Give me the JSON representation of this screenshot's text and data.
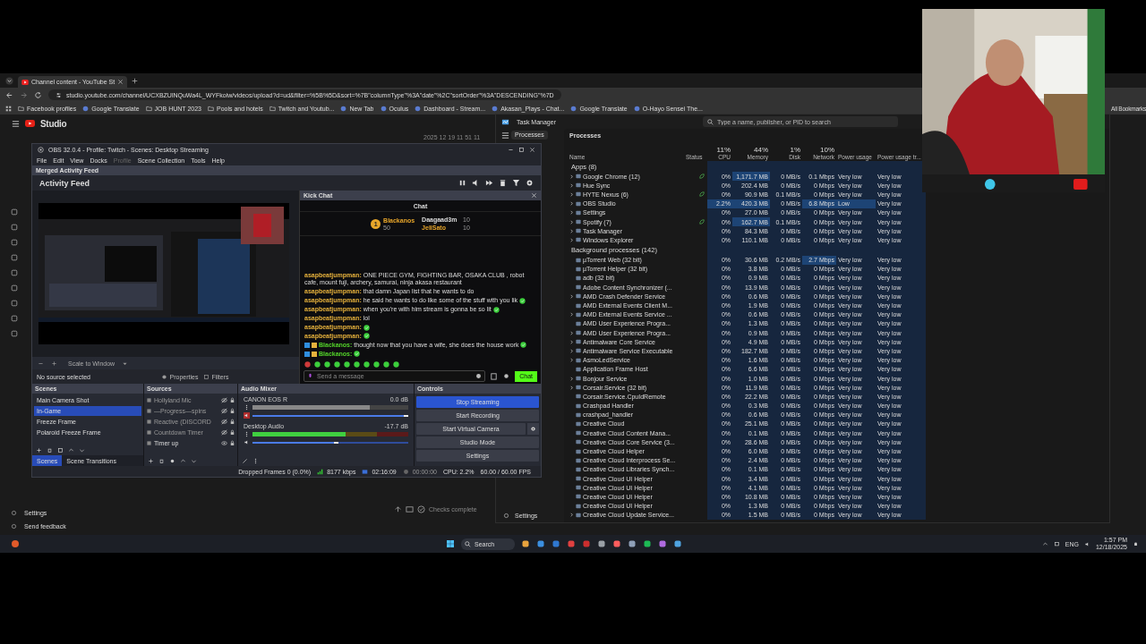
{
  "browser": {
    "tab": {
      "title": "Channel content - YouTube St"
    },
    "url": "studio.youtube.com/channel/UCXBZUlNQuWa4L_WYFkoiw/videos/upload?d=ud&filter=%5B%5D&sort=%7B\"columnType\"%3A\"date\"%2C\"sortOrder\"%3A\"DESCENDING\"%7D",
    "bookmarks": [
      {
        "label": "Facebook profiles",
        "kind": "folder"
      },
      {
        "label": "Google Translate",
        "kind": "site"
      },
      {
        "label": "JOB HUNT 2023",
        "kind": "folder"
      },
      {
        "label": "Pools and hotels",
        "kind": "folder"
      },
      {
        "label": "Twitch and Youtub...",
        "kind": "folder"
      },
      {
        "label": "New Tab",
        "kind": "site"
      },
      {
        "label": "Oculus",
        "kind": "site"
      },
      {
        "label": "Dashboard - Stream...",
        "kind": "site"
      },
      {
        "label": "Akasan_Plays - Chat...",
        "kind": "site"
      },
      {
        "label": "Google Translate",
        "kind": "site"
      },
      {
        "label": "O-Hayo Sensei The...",
        "kind": "site"
      }
    ],
    "all_bookmarks": "All Bookmarks"
  },
  "studio": {
    "logo": "Studio",
    "sidebar_footer": [
      "Settings",
      "Send feedback"
    ],
    "upload_status": "Checks complete"
  },
  "timestamp": "2025 12 19 11 51 11",
  "obs": {
    "title": "OBS 32.0.4 - Profile: Twitch - Scenes: Desktop Streaming",
    "menu": [
      {
        "label": "File",
        "disabled": false
      },
      {
        "label": "Edit",
        "disabled": false
      },
      {
        "label": "View",
        "disabled": false
      },
      {
        "label": "Docks",
        "disabled": false
      },
      {
        "label": "Profile",
        "disabled": true
      },
      {
        "label": "Scene Collection",
        "disabled": false
      },
      {
        "label": "Tools",
        "disabled": false
      },
      {
        "label": "Help",
        "disabled": false
      }
    ],
    "dock_title": "Merged Activity Feed",
    "feed_title": "Activity Feed",
    "scale": "Scale to Window",
    "no_source": "No source selected",
    "properties": "Properties",
    "filters": "Filters",
    "chat": {
      "dock_title": "Kick Chat",
      "title": "Chat",
      "leaders": [
        {
          "rank": "1",
          "name": "Blackanos",
          "count": "50"
        },
        {
          "name": "Daagaad3m",
          "count": "10"
        },
        {
          "name": "JeliSato",
          "count": "10"
        }
      ],
      "messages": [
        {
          "user": "asapbeatjumpman:",
          "color": "#e6b13c",
          "badges": false,
          "text": "ONE PIECE GYM, FIGHTING BAR, OSAKA CLUB , robot cafe, mount fuji, archery, samurai, ninja akasa restaurant",
          "emote": false
        },
        {
          "user": "asapbeatjumpman:",
          "color": "#e6b13c",
          "badges": false,
          "text": "that damn Japan list that he wants to do",
          "emote": false
        },
        {
          "user": "asapbeatjumpman:",
          "color": "#e6b13c",
          "badges": false,
          "text": "he said he wants to do like some of the stuff with you lik",
          "emote": true
        },
        {
          "user": "asapbeatjumpman:",
          "color": "#e6b13c",
          "badges": false,
          "text": "when you're with him stream is gonna be so lit",
          "emote": true
        },
        {
          "user": "asapbeatjumpman:",
          "color": "#e6b13c",
          "badges": false,
          "text": "lol",
          "emote": false
        },
        {
          "user": "asapbeatjumpman:",
          "color": "#e6b13c",
          "badges": false,
          "emote": true
        },
        {
          "user": "asapbeatjumpman:",
          "color": "#e6b13c",
          "badges": false,
          "emote": true
        },
        {
          "user": "Blackanos:",
          "color": "#53d22a",
          "badges": true,
          "text": "thought now that you have a wife, she does the house work",
          "emote": true
        },
        {
          "user": "Blackanos:",
          "color": "#53d22a",
          "badges": true,
          "emote": true
        }
      ],
      "placeholder": "Send a message",
      "send": "Chat"
    },
    "scenes_title": "Scenes",
    "scenes": [
      {
        "name": "Main Camera Shot",
        "selected": false
      },
      {
        "name": "In-Game",
        "selected": true
      },
      {
        "name": "Freeze Frame",
        "selected": false
      },
      {
        "name": "Polaroid Freeze Frame",
        "selected": false
      }
    ],
    "scene_tabs": [
      {
        "label": "Scenes",
        "selected": true
      },
      {
        "label": "Scene Transitions",
        "selected": false
      }
    ],
    "sources_title": "Sources",
    "sources": [
      {
        "name": "Hollyland Mic",
        "visible": false
      },
      {
        "name": "—Progress—spins",
        "visible": false
      },
      {
        "name": "Reactive (DISCORD",
        "visible": false
      },
      {
        "name": "Countdown Timer",
        "visible": false
      },
      {
        "name": "Timer up",
        "visible": true
      }
    ],
    "mixer_title": "Audio Mixer",
    "channels": [
      {
        "name": "CANON EOS R",
        "reading": "0.0 dB",
        "level": 0.75,
        "volume": {
          "level": 1
        },
        "muted": true
      },
      {
        "name": "Desktop Audio",
        "reading": "-17.7 dB",
        "level": 0.6,
        "volume": {
          "level": 0.55
        },
        "muted": false
      }
    ],
    "controls_title": "Controls",
    "controls": [
      {
        "label": "Stop Streaming",
        "active": true,
        "gear": false
      },
      {
        "label": "Start Recording",
        "active": false,
        "gear": false
      },
      {
        "label": "Start Virtual Camera",
        "active": false,
        "gear": true
      },
      {
        "label": "Studio Mode",
        "active": false,
        "gear": false
      },
      {
        "label": "Settings",
        "active": false,
        "gear": false
      }
    ],
    "status": [
      {
        "kind": "text",
        "text": "Dropped Frames 0 (0.0%)"
      },
      {
        "kind": "signal",
        "text": "8177 kbps"
      },
      {
        "kind": "stream",
        "text": "02:16:09"
      },
      {
        "kind": "record",
        "text": "00:00:00"
      },
      {
        "kind": "text",
        "text": "CPU: 2.2%"
      },
      {
        "kind": "text",
        "text": "60.00 / 60.00 FPS"
      }
    ]
  },
  "task_manager": {
    "title": "Task Manager",
    "search": {
      "placeholder": "Type a name, publisher, or PID to search"
    },
    "nav": [
      {
        "label": "Processes",
        "selected": true
      }
    ],
    "settings": "Settings",
    "heading": "Processes",
    "columns": [
      {
        "label": "Name"
      },
      {
        "label": "Status"
      },
      {
        "percent": "11%",
        "label": "CPU"
      },
      {
        "percent": "44%",
        "label": "Memory"
      },
      {
        "percent": "1%",
        "label": "Disk"
      },
      {
        "percent": "10%",
        "label": "Network"
      },
      {
        "label": "Power usage"
      },
      {
        "label": "Power usage tr..."
      }
    ],
    "groups": [
      {
        "title": "Apps (8)",
        "rows": [
          {
            "name": "Google Chrome (12)",
            "expandable": true,
            "eco": true,
            "cpu": "0%",
            "memory": "1,171.7 MB",
            "disk": "0 MB/s",
            "network": "0.1 Mbps",
            "power": "Very low",
            "trend": "Very low",
            "hot": {
              "memory": true
            }
          },
          {
            "name": "Hue Sync",
            "expandable": true,
            "eco": false,
            "cpu": "0%",
            "memory": "202.4 MB",
            "disk": "0 MB/s",
            "network": "0 Mbps",
            "power": "Very low",
            "trend": "Very low"
          },
          {
            "name": "HYTE Nexus (6)",
            "expandable": true,
            "eco": true,
            "cpu": "0%",
            "memory": "90.9 MB",
            "disk": "0.1 MB/s",
            "network": "0 Mbps",
            "power": "Very low",
            "trend": "Very low"
          },
          {
            "name": "OBS Studio",
            "expandable": true,
            "eco": false,
            "cpu": "2.2%",
            "memory": "420.3 MB",
            "disk": "0 MB/s",
            "network": "6.8 Mbps",
            "power": "Low",
            "trend": "Very low",
            "hot": {
              "cpu": true,
              "memory": true,
              "network": true,
              "power": true
            }
          },
          {
            "name": "Settings",
            "expandable": true,
            "eco": false,
            "cpu": "0%",
            "memory": "27.0 MB",
            "disk": "0 MB/s",
            "network": "0 Mbps",
            "power": "Very low",
            "trend": "Very low"
          },
          {
            "name": "Spotify (7)",
            "expandable": true,
            "eco": true,
            "cpu": "0%",
            "memory": "162.7 MB",
            "disk": "0.1 MB/s",
            "network": "0 Mbps",
            "power": "Very low",
            "trend": "Very low",
            "hot": {
              "memory": true
            }
          },
          {
            "name": "Task Manager",
            "expandable": true,
            "eco": false,
            "cpu": "0%",
            "memory": "84.3 MB",
            "disk": "0 MB/s",
            "network": "0 Mbps",
            "power": "Very low",
            "trend": "Very low"
          },
          {
            "name": "Windows Explorer",
            "expandable": true,
            "eco": false,
            "cpu": "0%",
            "memory": "110.1 MB",
            "disk": "0 MB/s",
            "network": "0 Mbps",
            "power": "Very low",
            "trend": "Very low"
          }
        ]
      },
      {
        "title": "Background processes (142)",
        "rows": [
          {
            "name": "µTorrent Web (32 bit)",
            "expandable": false,
            "eco": false,
            "cpu": "0%",
            "memory": "30.6 MB",
            "disk": "0.2 MB/s",
            "network": "2.7 Mbps",
            "power": "Very low",
            "trend": "Very low",
            "hot": {
              "network": true
            }
          },
          {
            "name": "µTorrent Helper (32 bit)",
            "expandable": false,
            "eco": false,
            "cpu": "0%",
            "memory": "3.8 MB",
            "disk": "0 MB/s",
            "network": "0 Mbps",
            "power": "Very low",
            "trend": "Very low"
          },
          {
            "name": "adb (32 bit)",
            "expandable": false,
            "eco": false,
            "cpu": "0%",
            "memory": "0.9 MB",
            "disk": "0 MB/s",
            "network": "0 Mbps",
            "power": "Very low",
            "trend": "Very low"
          },
          {
            "name": "Adobe Content Synchronizer (...",
            "expandable": false,
            "eco": false,
            "cpu": "0%",
            "memory": "13.9 MB",
            "disk": "0 MB/s",
            "network": "0 Mbps",
            "power": "Very low",
            "trend": "Very low"
          },
          {
            "name": "AMD Crash Defender Service",
            "expandable": true,
            "eco": false,
            "cpu": "0%",
            "memory": "0.6 MB",
            "disk": "0 MB/s",
            "network": "0 Mbps",
            "power": "Very low",
            "trend": "Very low"
          },
          {
            "name": "AMD External Events Client M...",
            "expandable": false,
            "eco": false,
            "cpu": "0%",
            "memory": "1.9 MB",
            "disk": "0 MB/s",
            "network": "0 Mbps",
            "power": "Very low",
            "trend": "Very low"
          },
          {
            "name": "AMD External Events Service ...",
            "expandable": true,
            "eco": false,
            "cpu": "0%",
            "memory": "0.6 MB",
            "disk": "0 MB/s",
            "network": "0 Mbps",
            "power": "Very low",
            "trend": "Very low"
          },
          {
            "name": "AMD User Experience Progra...",
            "expandable": false,
            "eco": false,
            "cpu": "0%",
            "memory": "1.3 MB",
            "disk": "0 MB/s",
            "network": "0 Mbps",
            "power": "Very low",
            "trend": "Very low"
          },
          {
            "name": "AMD User Experience Progra...",
            "expandable": true,
            "eco": false,
            "cpu": "0%",
            "memory": "0.9 MB",
            "disk": "0 MB/s",
            "network": "0 Mbps",
            "power": "Very low",
            "trend": "Very low"
          },
          {
            "name": "Antimalware Core Service",
            "expandable": true,
            "eco": false,
            "cpu": "0%",
            "memory": "4.9 MB",
            "disk": "0 MB/s",
            "network": "0 Mbps",
            "power": "Very low",
            "trend": "Very low"
          },
          {
            "name": "Antimalware Service Executable",
            "expandable": true,
            "eco": false,
            "cpu": "0%",
            "memory": "182.7 MB",
            "disk": "0 MB/s",
            "network": "0 Mbps",
            "power": "Very low",
            "trend": "Very low"
          },
          {
            "name": "AsmoLedService",
            "expandable": true,
            "eco": false,
            "cpu": "0%",
            "memory": "1.6 MB",
            "disk": "0 MB/s",
            "network": "0 Mbps",
            "power": "Very low",
            "trend": "Very low"
          },
          {
            "name": "Application Frame Host",
            "expandable": false,
            "eco": false,
            "cpu": "0%",
            "memory": "6.6 MB",
            "disk": "0 MB/s",
            "network": "0 Mbps",
            "power": "Very low",
            "trend": "Very low"
          },
          {
            "name": "Bonjour Service",
            "expandable": true,
            "eco": false,
            "cpu": "0%",
            "memory": "1.0 MB",
            "disk": "0 MB/s",
            "network": "0 Mbps",
            "power": "Very low",
            "trend": "Very low"
          },
          {
            "name": "Corsair.Service (32 bit)",
            "expandable": true,
            "eco": false,
            "cpu": "0%",
            "memory": "11.9 MB",
            "disk": "0 MB/s",
            "network": "0 Mbps",
            "power": "Very low",
            "trend": "Very low"
          },
          {
            "name": "Corsair.Service.CpuIdRemote",
            "expandable": false,
            "eco": false,
            "cpu": "0%",
            "memory": "22.2 MB",
            "disk": "0 MB/s",
            "network": "0 Mbps",
            "power": "Very low",
            "trend": "Very low"
          },
          {
            "name": "Crashpad Handler",
            "expandable": false,
            "eco": false,
            "cpu": "0%",
            "memory": "0.3 MB",
            "disk": "0 MB/s",
            "network": "0 Mbps",
            "power": "Very low",
            "trend": "Very low"
          },
          {
            "name": "crashpad_handler",
            "expandable": false,
            "eco": false,
            "cpu": "0%",
            "memory": "0.6 MB",
            "disk": "0 MB/s",
            "network": "0 Mbps",
            "power": "Very low",
            "trend": "Very low"
          },
          {
            "name": "Creative Cloud",
            "expandable": false,
            "eco": false,
            "cpu": "0%",
            "memory": "25.1 MB",
            "disk": "0 MB/s",
            "network": "0 Mbps",
            "power": "Very low",
            "trend": "Very low"
          },
          {
            "name": "Creative Cloud Content Mana...",
            "expandable": false,
            "eco": false,
            "cpu": "0%",
            "memory": "0.1 MB",
            "disk": "0 MB/s",
            "network": "0 Mbps",
            "power": "Very low",
            "trend": "Very low"
          },
          {
            "name": "Creative Cloud Core Service (3...",
            "expandable": false,
            "eco": false,
            "cpu": "0%",
            "memory": "28.6 MB",
            "disk": "0 MB/s",
            "network": "0 Mbps",
            "power": "Very low",
            "trend": "Very low"
          },
          {
            "name": "Creative Cloud Helper",
            "expandable": false,
            "eco": false,
            "cpu": "0%",
            "memory": "6.0 MB",
            "disk": "0 MB/s",
            "network": "0 Mbps",
            "power": "Very low",
            "trend": "Very low"
          },
          {
            "name": "Creative Cloud Interprocess Se...",
            "expandable": false,
            "eco": false,
            "cpu": "0%",
            "memory": "2.4 MB",
            "disk": "0 MB/s",
            "network": "0 Mbps",
            "power": "Very low",
            "trend": "Very low"
          },
          {
            "name": "Creative Cloud Libraries Synch...",
            "expandable": false,
            "eco": false,
            "cpu": "0%",
            "memory": "0.1 MB",
            "disk": "0 MB/s",
            "network": "0 Mbps",
            "power": "Very low",
            "trend": "Very low"
          },
          {
            "name": "Creative Cloud UI Helper",
            "expandable": false,
            "eco": false,
            "cpu": "0%",
            "memory": "3.4 MB",
            "disk": "0 MB/s",
            "network": "0 Mbps",
            "power": "Very low",
            "trend": "Very low"
          },
          {
            "name": "Creative Cloud UI Helper",
            "expandable": false,
            "eco": false,
            "cpu": "0%",
            "memory": "4.1 MB",
            "disk": "0 MB/s",
            "network": "0 Mbps",
            "power": "Very low",
            "trend": "Very low"
          },
          {
            "name": "Creative Cloud UI Helper",
            "expandable": false,
            "eco": false,
            "cpu": "0%",
            "memory": "10.8 MB",
            "disk": "0 MB/s",
            "network": "0 Mbps",
            "power": "Very low",
            "trend": "Very low"
          },
          {
            "name": "Creative Cloud UI Helper",
            "expandable": false,
            "eco": false,
            "cpu": "0%",
            "memory": "1.3 MB",
            "disk": "0 MB/s",
            "network": "0 Mbps",
            "power": "Very low",
            "trend": "Very low"
          },
          {
            "name": "Creative Cloud Update Service...",
            "expandable": true,
            "eco": false,
            "cpu": "0%",
            "memory": "1.5 MB",
            "disk": "0 MB/s",
            "network": "0 Mbps",
            "power": "Very low",
            "trend": "Very low"
          }
        ]
      }
    ]
  },
  "taskbar": {
    "search": "Search",
    "language": "ENG",
    "time": "1:57 PM",
    "date": "12/18/2025"
  }
}
